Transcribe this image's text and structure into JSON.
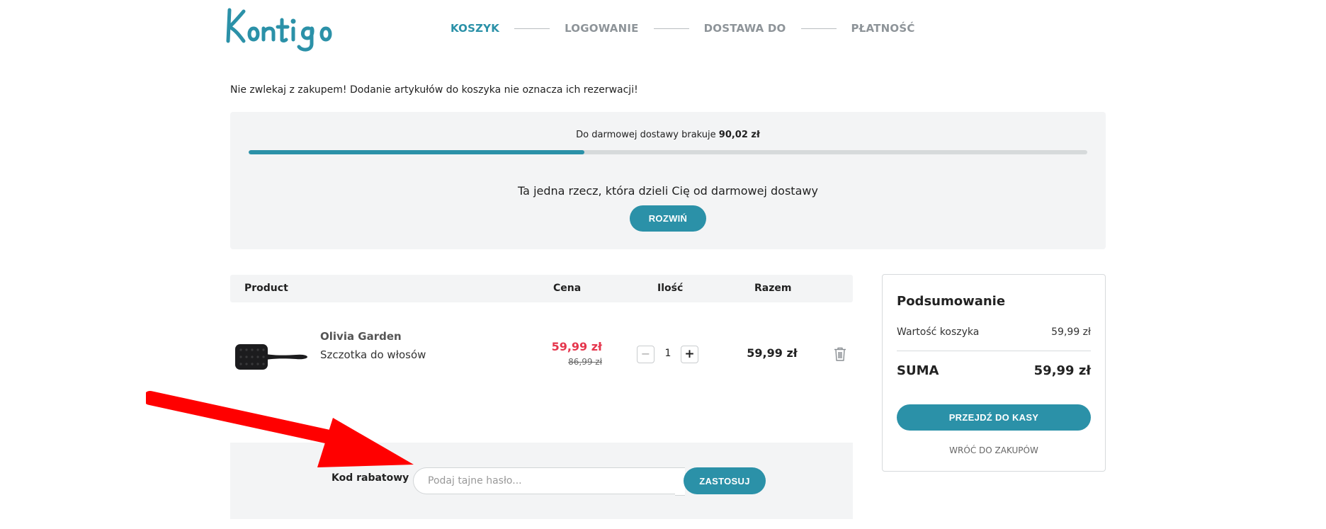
{
  "brand": {
    "logo_text": "Kontigo",
    "accent_color": "#2b91a8",
    "sale_color": "#e5364d"
  },
  "steps": [
    {
      "label": "KOSZYK",
      "active": true
    },
    {
      "label": "LOGOWANIE",
      "active": false
    },
    {
      "label": "DOSTAWA DO",
      "active": false
    },
    {
      "label": "PŁATNOŚĆ",
      "active": false
    }
  ],
  "notice": "Nie zwlekaj z zakupem! Dodanie artykułów do koszyka nie oznacza ich rezerwacji!",
  "shipping": {
    "text_prefix": "Do darmowej dostawy brakuje",
    "amount": "90,02 zł",
    "progress_percent": 40,
    "upsell_text": "Ta jedna rzecz, która dzieli Cię od darmowej dostawy",
    "expand_label": "ROZWIŃ"
  },
  "cart_table": {
    "headers": {
      "product": "Product",
      "price": "Cena",
      "qty": "Ilość",
      "total": "Razem"
    },
    "items": [
      {
        "brand": "Olivia Garden",
        "name": "Szczotka do włosów",
        "image_icon": "paddle-brush-icon",
        "price_new": "59,99 zł",
        "price_old": "86,99 zł",
        "qty": "1",
        "qty_minus": "−",
        "qty_plus": "+",
        "total": "59,99 zł",
        "remove_icon": "trash-icon"
      }
    ]
  },
  "discount": {
    "label": "Kod rabatowy",
    "placeholder": "Podaj tajne hasło...",
    "value": "",
    "apply_label": "ZASTOSUJ"
  },
  "summary": {
    "title": "Podsumowanie",
    "cart_value_label": "Wartość koszyka",
    "cart_value": "59,99 zł",
    "total_label": "SUMA",
    "total_value": "59,99 zł",
    "checkout_label": "PRZEJDŹ DO KASY",
    "back_label": "WRÓĆ DO ZAKUPÓW"
  },
  "annotation": {
    "icon": "red-arrow-icon",
    "color": "#ff0000"
  }
}
